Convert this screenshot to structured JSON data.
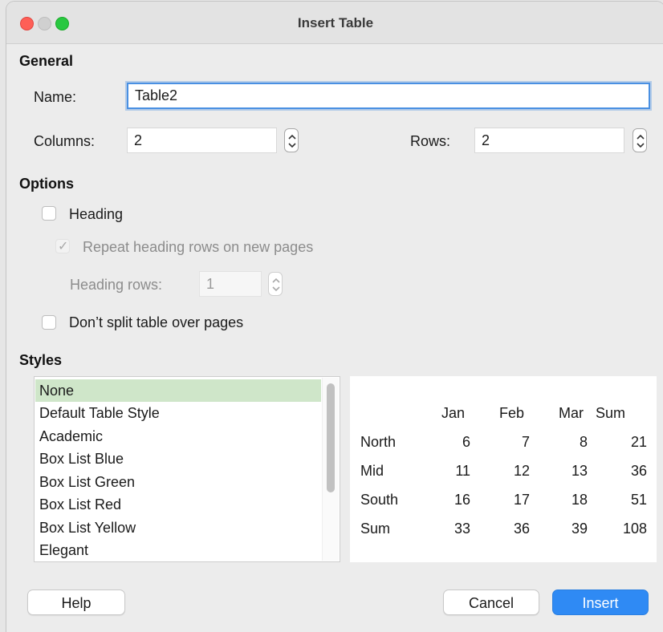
{
  "window": {
    "title": "Insert Table"
  },
  "general": {
    "section_label": "General",
    "name_label": "Name:",
    "name_value": "Table2",
    "columns_label": "Columns:",
    "columns_value": "2",
    "rows_label": "Rows:",
    "rows_value": "2"
  },
  "options": {
    "section_label": "Options",
    "heading_label": "Heading",
    "heading_checked": false,
    "repeat_heading_label": "Repeat heading rows on new pages",
    "repeat_heading_checked": true,
    "heading_rows_label": "Heading rows:",
    "heading_rows_value": "1",
    "dont_split_label": "Don’t split table over pages",
    "dont_split_checked": false
  },
  "styles": {
    "section_label": "Styles",
    "items": [
      "None",
      "Default Table Style",
      "Academic",
      "Box List Blue",
      "Box List Green",
      "Box List Red",
      "Box List Yellow",
      "Elegant"
    ],
    "selected": "None",
    "selection_color": "#cfe6c9"
  },
  "preview": {
    "headers": [
      "",
      "Jan",
      "Feb",
      "Mar",
      "Sum"
    ],
    "rows": [
      [
        "North",
        "6",
        "7",
        "8",
        "21"
      ],
      [
        "Mid",
        "11",
        "12",
        "13",
        "36"
      ],
      [
        "South",
        "16",
        "17",
        "18",
        "51"
      ],
      [
        "Sum",
        "33",
        "36",
        "39",
        "108"
      ]
    ]
  },
  "buttons": {
    "help": "Help",
    "cancel": "Cancel",
    "insert": "Insert"
  },
  "colors": {
    "accent": "#2f8af4",
    "close": "#fe5f57",
    "maximize": "#28c840"
  }
}
